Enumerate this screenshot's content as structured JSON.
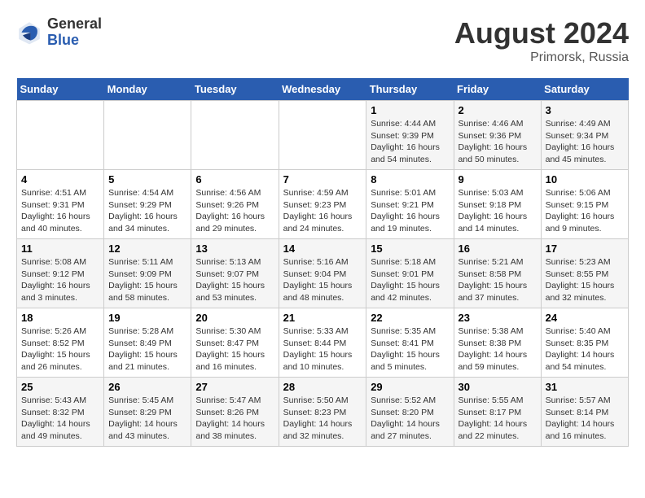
{
  "header": {
    "logo_general": "General",
    "logo_blue": "Blue",
    "month_year": "August 2024",
    "location": "Primorsk, Russia"
  },
  "weekdays": [
    "Sunday",
    "Monday",
    "Tuesday",
    "Wednesday",
    "Thursday",
    "Friday",
    "Saturday"
  ],
  "weeks": [
    [
      {
        "day": "",
        "info": ""
      },
      {
        "day": "",
        "info": ""
      },
      {
        "day": "",
        "info": ""
      },
      {
        "day": "",
        "info": ""
      },
      {
        "day": "1",
        "info": "Sunrise: 4:44 AM\nSunset: 9:39 PM\nDaylight: 16 hours\nand 54 minutes."
      },
      {
        "day": "2",
        "info": "Sunrise: 4:46 AM\nSunset: 9:36 PM\nDaylight: 16 hours\nand 50 minutes."
      },
      {
        "day": "3",
        "info": "Sunrise: 4:49 AM\nSunset: 9:34 PM\nDaylight: 16 hours\nand 45 minutes."
      }
    ],
    [
      {
        "day": "4",
        "info": "Sunrise: 4:51 AM\nSunset: 9:31 PM\nDaylight: 16 hours\nand 40 minutes."
      },
      {
        "day": "5",
        "info": "Sunrise: 4:54 AM\nSunset: 9:29 PM\nDaylight: 16 hours\nand 34 minutes."
      },
      {
        "day": "6",
        "info": "Sunrise: 4:56 AM\nSunset: 9:26 PM\nDaylight: 16 hours\nand 29 minutes."
      },
      {
        "day": "7",
        "info": "Sunrise: 4:59 AM\nSunset: 9:23 PM\nDaylight: 16 hours\nand 24 minutes."
      },
      {
        "day": "8",
        "info": "Sunrise: 5:01 AM\nSunset: 9:21 PM\nDaylight: 16 hours\nand 19 minutes."
      },
      {
        "day": "9",
        "info": "Sunrise: 5:03 AM\nSunset: 9:18 PM\nDaylight: 16 hours\nand 14 minutes."
      },
      {
        "day": "10",
        "info": "Sunrise: 5:06 AM\nSunset: 9:15 PM\nDaylight: 16 hours\nand 9 minutes."
      }
    ],
    [
      {
        "day": "11",
        "info": "Sunrise: 5:08 AM\nSunset: 9:12 PM\nDaylight: 16 hours\nand 3 minutes."
      },
      {
        "day": "12",
        "info": "Sunrise: 5:11 AM\nSunset: 9:09 PM\nDaylight: 15 hours\nand 58 minutes."
      },
      {
        "day": "13",
        "info": "Sunrise: 5:13 AM\nSunset: 9:07 PM\nDaylight: 15 hours\nand 53 minutes."
      },
      {
        "day": "14",
        "info": "Sunrise: 5:16 AM\nSunset: 9:04 PM\nDaylight: 15 hours\nand 48 minutes."
      },
      {
        "day": "15",
        "info": "Sunrise: 5:18 AM\nSunset: 9:01 PM\nDaylight: 15 hours\nand 42 minutes."
      },
      {
        "day": "16",
        "info": "Sunrise: 5:21 AM\nSunset: 8:58 PM\nDaylight: 15 hours\nand 37 minutes."
      },
      {
        "day": "17",
        "info": "Sunrise: 5:23 AM\nSunset: 8:55 PM\nDaylight: 15 hours\nand 32 minutes."
      }
    ],
    [
      {
        "day": "18",
        "info": "Sunrise: 5:26 AM\nSunset: 8:52 PM\nDaylight: 15 hours\nand 26 minutes."
      },
      {
        "day": "19",
        "info": "Sunrise: 5:28 AM\nSunset: 8:49 PM\nDaylight: 15 hours\nand 21 minutes."
      },
      {
        "day": "20",
        "info": "Sunrise: 5:30 AM\nSunset: 8:47 PM\nDaylight: 15 hours\nand 16 minutes."
      },
      {
        "day": "21",
        "info": "Sunrise: 5:33 AM\nSunset: 8:44 PM\nDaylight: 15 hours\nand 10 minutes."
      },
      {
        "day": "22",
        "info": "Sunrise: 5:35 AM\nSunset: 8:41 PM\nDaylight: 15 hours\nand 5 minutes."
      },
      {
        "day": "23",
        "info": "Sunrise: 5:38 AM\nSunset: 8:38 PM\nDaylight: 14 hours\nand 59 minutes."
      },
      {
        "day": "24",
        "info": "Sunrise: 5:40 AM\nSunset: 8:35 PM\nDaylight: 14 hours\nand 54 minutes."
      }
    ],
    [
      {
        "day": "25",
        "info": "Sunrise: 5:43 AM\nSunset: 8:32 PM\nDaylight: 14 hours\nand 49 minutes."
      },
      {
        "day": "26",
        "info": "Sunrise: 5:45 AM\nSunset: 8:29 PM\nDaylight: 14 hours\nand 43 minutes."
      },
      {
        "day": "27",
        "info": "Sunrise: 5:47 AM\nSunset: 8:26 PM\nDaylight: 14 hours\nand 38 minutes."
      },
      {
        "day": "28",
        "info": "Sunrise: 5:50 AM\nSunset: 8:23 PM\nDaylight: 14 hours\nand 32 minutes."
      },
      {
        "day": "29",
        "info": "Sunrise: 5:52 AM\nSunset: 8:20 PM\nDaylight: 14 hours\nand 27 minutes."
      },
      {
        "day": "30",
        "info": "Sunrise: 5:55 AM\nSunset: 8:17 PM\nDaylight: 14 hours\nand 22 minutes."
      },
      {
        "day": "31",
        "info": "Sunrise: 5:57 AM\nSunset: 8:14 PM\nDaylight: 14 hours\nand 16 minutes."
      }
    ]
  ]
}
